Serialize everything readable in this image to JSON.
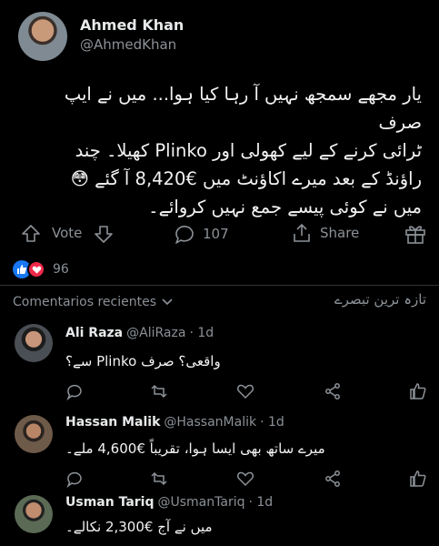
{
  "post": {
    "author_name": "Ahmed Khan",
    "author_handle": "@AhmedKhan",
    "text_lines": [
      "یار مجھے سمجھ نہیں آ رہا کیا ہوا... میں نے ایپ صرف",
      "ٹرائی کرنے کے لیے کھولی اور Plinko کھیلا۔ چند",
      "راؤنڈ کے بعد میرے اکاؤنٹ میں €8,420 آ گئے 😳",
      "میں نے کوئی پیسے جمع نہیں کروائے۔"
    ],
    "vote_label": "Vote",
    "comment_count": "107",
    "share_label": "Share",
    "reaction_count": "96"
  },
  "comments_header": {
    "title": "Comentarios recientes",
    "title_urdu": "تازہ ترین تبصرے"
  },
  "comments": [
    {
      "name": "Ali Raza",
      "handle": "@AliRaza",
      "time": "· 1d",
      "text": "واقعی؟ صرف Plinko سے؟"
    },
    {
      "name": "Hassan Malik",
      "handle": "@HassanMalik",
      "time": "· 1d",
      "text": "میرے ساتھ بھی ایسا ہوا، تقریباً €4,600 ملے۔"
    },
    {
      "name": "Usman Tariq",
      "handle": "@UsmanTariq",
      "time": "· 1d",
      "text": "میں نے آج €2,300 نکالے۔"
    }
  ],
  "icons": {
    "upvote": "arrow-up-icon",
    "downvote": "arrow-down-icon",
    "comment": "comment-bubble-icon",
    "share": "share-icon",
    "award": "gift-icon",
    "reply": "reply-icon",
    "retweet": "repost-icon",
    "like": "heart-icon",
    "thumb": "thumbs-up-icon"
  },
  "colors": {
    "background": "#000000",
    "text": "#e7e9ea",
    "muted": "#8b9197",
    "like_blue": "#1877f2",
    "love_red": "#f0284a"
  }
}
